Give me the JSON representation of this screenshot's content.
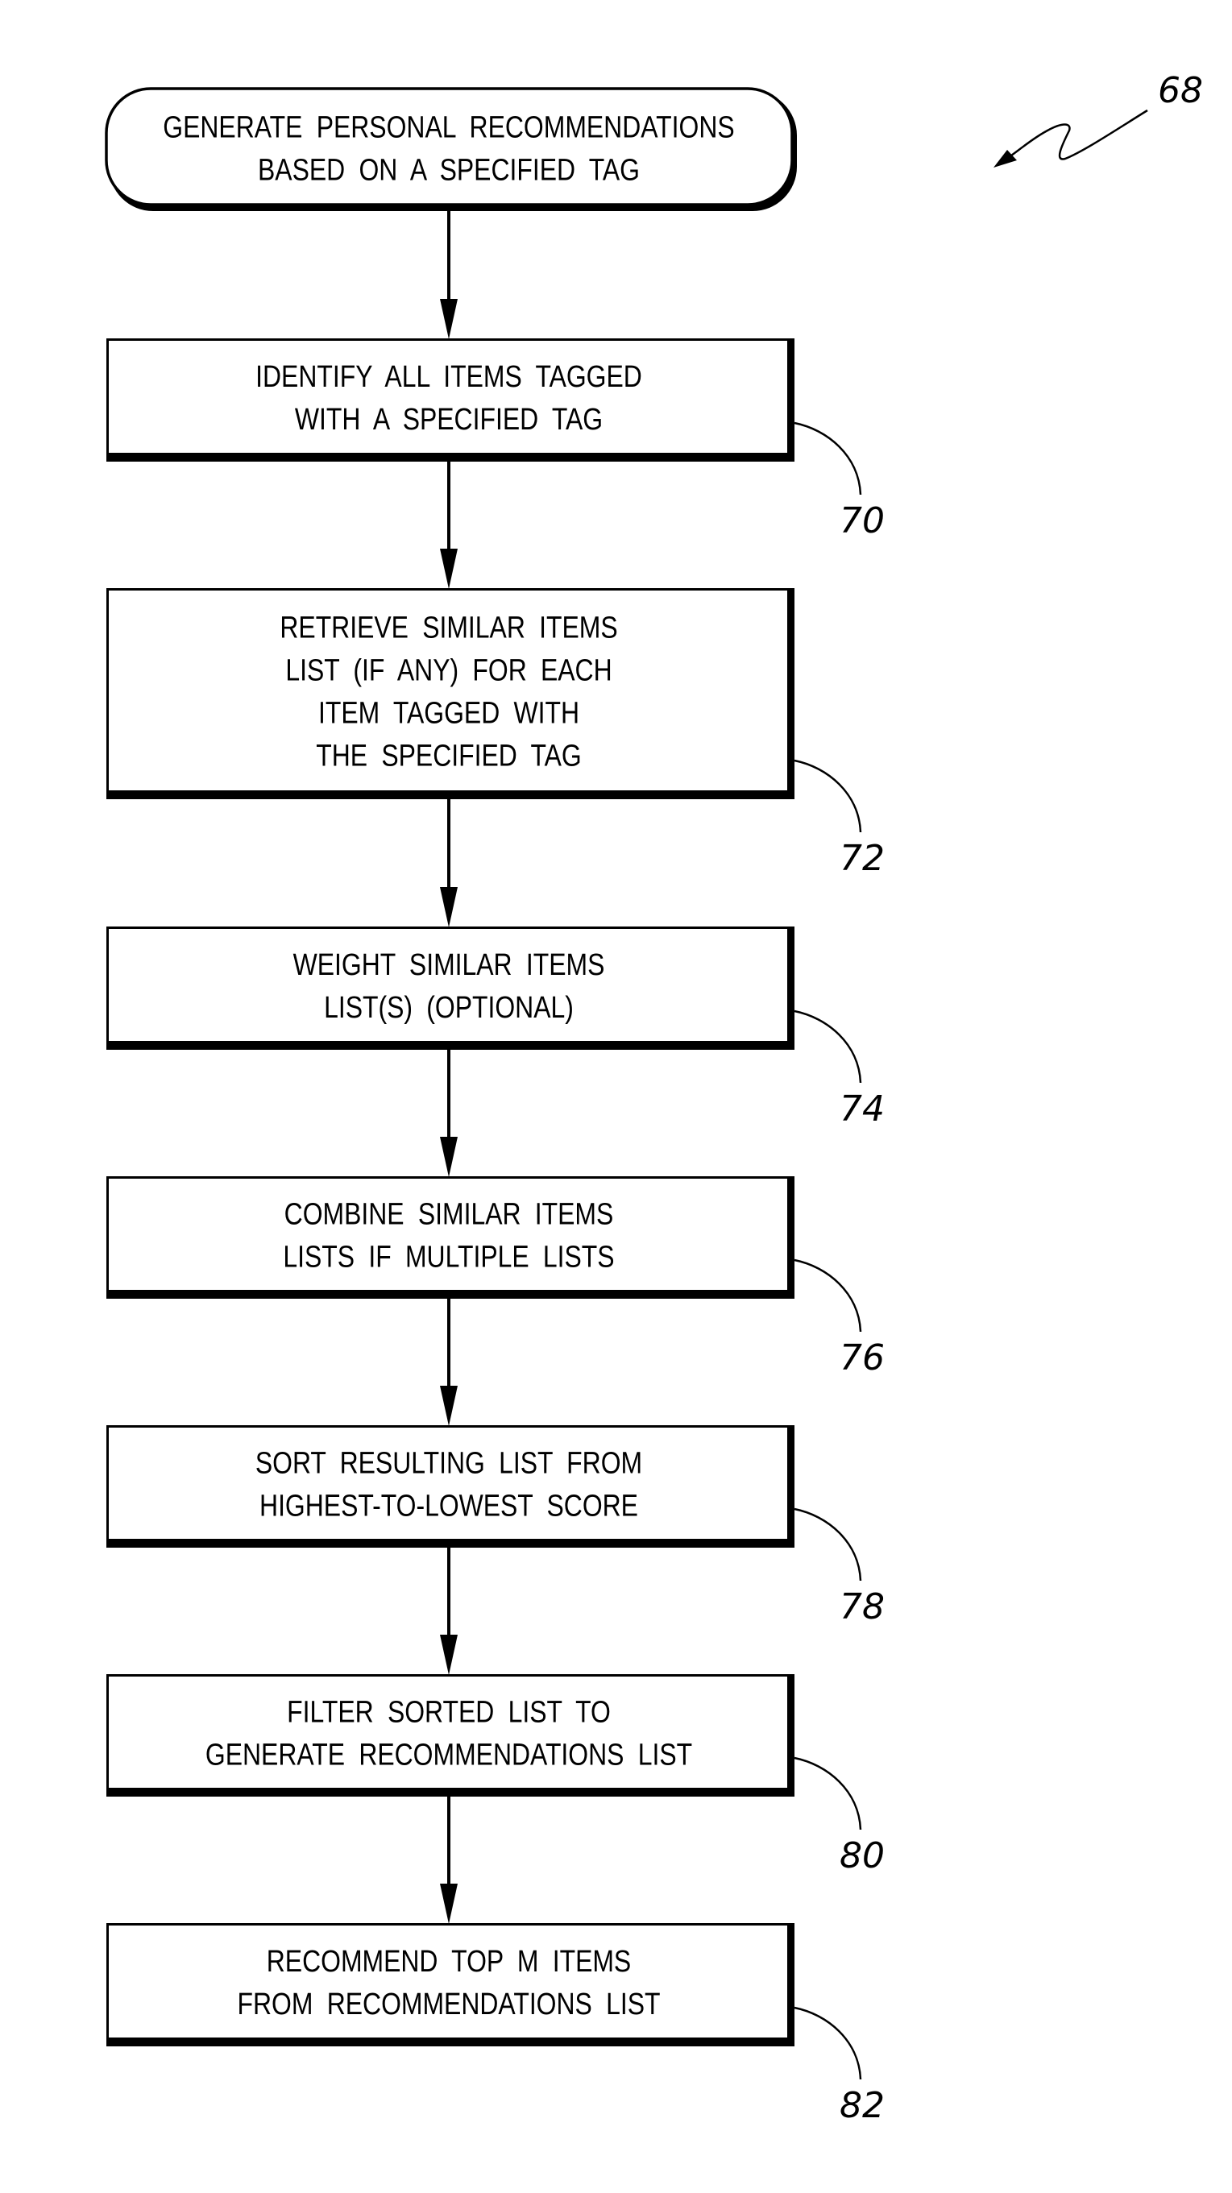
{
  "figure": {
    "reference_numeral": "68",
    "start": {
      "ref": null,
      "lines": [
        "GENERATE PERSONAL RECOMMENDATIONS",
        "BASED ON A SPECIFIED TAG"
      ]
    },
    "steps": [
      {
        "ref": "70",
        "lines": [
          "IDENTIFY ALL ITEMS TAGGED",
          "WITH A SPECIFIED TAG"
        ]
      },
      {
        "ref": "72",
        "lines": [
          "RETRIEVE SIMILAR ITEMS",
          "LIST (IF ANY) FOR EACH",
          "ITEM TAGGED WITH",
          "THE SPECIFIED TAG"
        ]
      },
      {
        "ref": "74",
        "lines": [
          "WEIGHT SIMILAR ITEMS",
          "LIST(S) (OPTIONAL)"
        ]
      },
      {
        "ref": "76",
        "lines": [
          "COMBINE SIMILAR ITEMS",
          "LISTS IF MULTIPLE LISTS"
        ]
      },
      {
        "ref": "78",
        "lines": [
          "SORT RESULTING LIST FROM",
          "HIGHEST-TO-LOWEST SCORE"
        ]
      },
      {
        "ref": "80",
        "lines": [
          "FILTER SORTED LIST TO",
          "GENERATE RECOMMENDATIONS LIST"
        ]
      },
      {
        "ref": "82",
        "lines": [
          "RECOMMEND TOP M ITEMS",
          "FROM RECOMMENDATIONS LIST"
        ]
      }
    ]
  },
  "colors": {
    "ink": "#000000",
    "paper": "#ffffff"
  }
}
